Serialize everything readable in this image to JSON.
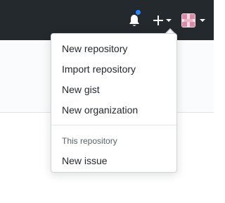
{
  "header": {
    "notifications_icon": "bell-icon",
    "notification_unread": true,
    "notification_dot_color": "#2188ff",
    "create_icon": "plus-icon",
    "create_caret_icon": "caret-down-icon",
    "avatar_caret_icon": "caret-down-icon",
    "background_color": "#24292e"
  },
  "create_menu": {
    "items": [
      {
        "label": "New repository"
      },
      {
        "label": "Import repository"
      },
      {
        "label": "New gist"
      },
      {
        "label": "New organization"
      }
    ],
    "section_header": "This repository",
    "section_items": [
      {
        "label": "New issue"
      }
    ]
  }
}
